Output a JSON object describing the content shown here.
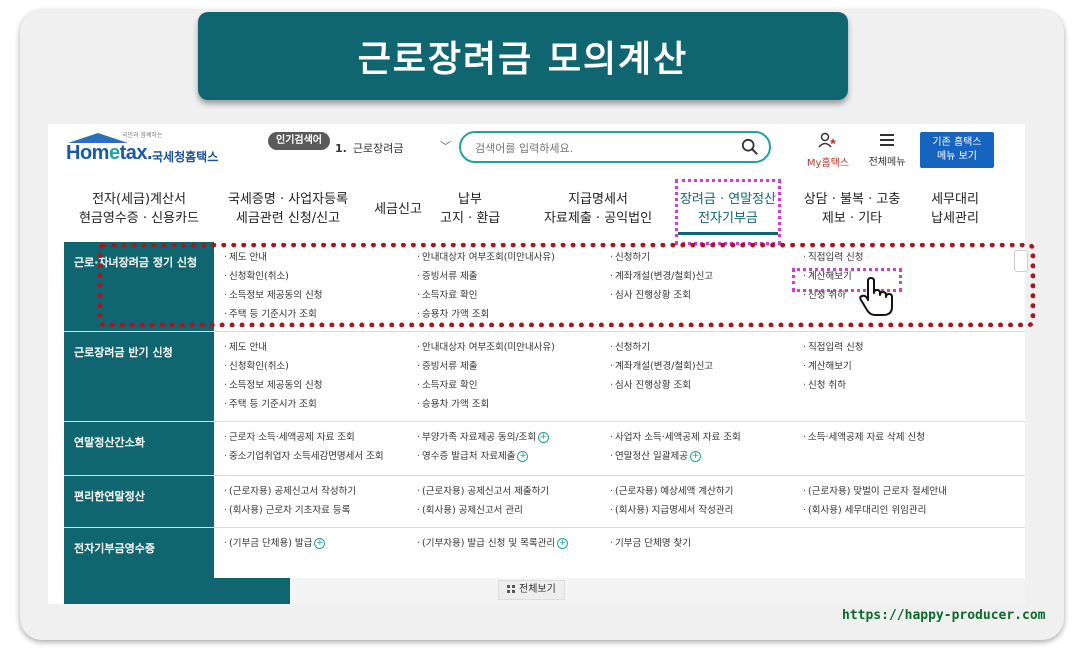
{
  "banner": {
    "title": "근로장려금 모의계산"
  },
  "header": {
    "logo_small": "국민과 함께하는",
    "logo_hom": "Hom",
    "logo_e": "e",
    "logo_tax": "tax.",
    "logo_kr": "국세청홈택스",
    "popular_label": "인기검색어",
    "popular_num": "1.",
    "popular_text": "근로장려금",
    "search_placeholder": "검색어를 입력하세요.",
    "myhome_label": "My홈택스",
    "allmenu_label": "전체메뉴",
    "old_home_line1": "기존 홈택스",
    "old_home_line2": "메뉴 보기"
  },
  "nav": [
    {
      "l1": "전자(세금)계산서",
      "l2": "현금영수증 · 신용카드"
    },
    {
      "l1": "국세증명 · 사업자등록",
      "l2": "세금관련 신청/신고"
    },
    {
      "l1": "세금신고",
      "l2": ""
    },
    {
      "l1": "납부",
      "l2": "고지 · 환급"
    },
    {
      "l1": "지급명세서",
      "l2": "자료제출 · 공익법인"
    },
    {
      "l1": "장려금 · 연말정산",
      "l2": "전자기부금"
    },
    {
      "l1": "상담 · 불복 · 고충",
      "l2": "제보 · 기타"
    },
    {
      "l1": "세무대리",
      "l2": "납세관리"
    }
  ],
  "menu": {
    "rows": [
      {
        "title": "근로·자녀장려금 정기 신청",
        "cols": [
          [
            "제도 안내",
            "신청확인(취소)",
            "소득정보 제공동의 신청",
            "주택 등 기준시가 조회"
          ],
          [
            "안내대상자 여부조회(미안내사유)",
            "증빙서류 제출",
            "소득자료 확인",
            "승용차 가액 조회"
          ],
          [
            "신청하기",
            "계좌개설(변경/철회)신고",
            "심사 진행상황 조회"
          ],
          [
            "직접입력 신청",
            "계산해보기",
            "신청 취하"
          ]
        ]
      },
      {
        "title": "근로장려금 반기 신청",
        "cols": [
          [
            "제도 안내",
            "신청확인(취소)",
            "소득정보 제공동의 신청",
            "주택 등 기준시가 조회"
          ],
          [
            "안내대상자 여부조회(미안내사유)",
            "증빙서류 제출",
            "소득자료 확인",
            "승용차 가액 조회"
          ],
          [
            "신청하기",
            "계좌개설(변경/철회)신고",
            "심사 진행상황 조회"
          ],
          [
            "직접입력 신청",
            "계산해보기",
            "신청 취하"
          ]
        ]
      },
      {
        "title": "연말정산간소화",
        "cols": [
          [
            "근로자 소득·세액공제 자료 조회",
            "중소기업취업자 소득세감면명세서 조회"
          ],
          [
            "부양가족 자료제공 동의/조회",
            "영수증 발급처 자료제출"
          ],
          [
            "사업자 소득·세액공제 자료 조회",
            "연말정산 일괄제공"
          ],
          [
            "소득·세액공제 자료 삭제 신청"
          ]
        ]
      },
      {
        "title": "편리한연말정산",
        "cols": [
          [
            "(근로자용) 공제신고서 작성하기",
            "(회사용) 근로자 기초자료 등록"
          ],
          [
            "(근로자용) 공제신고서 제출하기",
            "(회사용) 공제신고서 관리"
          ],
          [
            "(근로자용) 예상세액 계산하기",
            "(회사용) 지급명세서 작성관리"
          ],
          [
            "(근로자용) 맞벌이 근로자 절세안내",
            "(회사용) 세무대리인 위임관리"
          ]
        ]
      },
      {
        "title": "전자기부금영수증",
        "cols": [
          [
            "(기부금 단체용) 발급"
          ],
          [
            "(기부자용) 발급 신청 및 목록관리"
          ],
          [
            "기부금 단체명 찾기"
          ],
          []
        ]
      }
    ],
    "plus_symbol": "+",
    "full_view": "전체보기"
  },
  "footer_url": "https://happy-producer.com",
  "colors": {
    "teal": "#0f6670",
    "accent": "#1fa39a",
    "red_dots": "#b0131a",
    "pink_dots": "#d63ad6"
  }
}
